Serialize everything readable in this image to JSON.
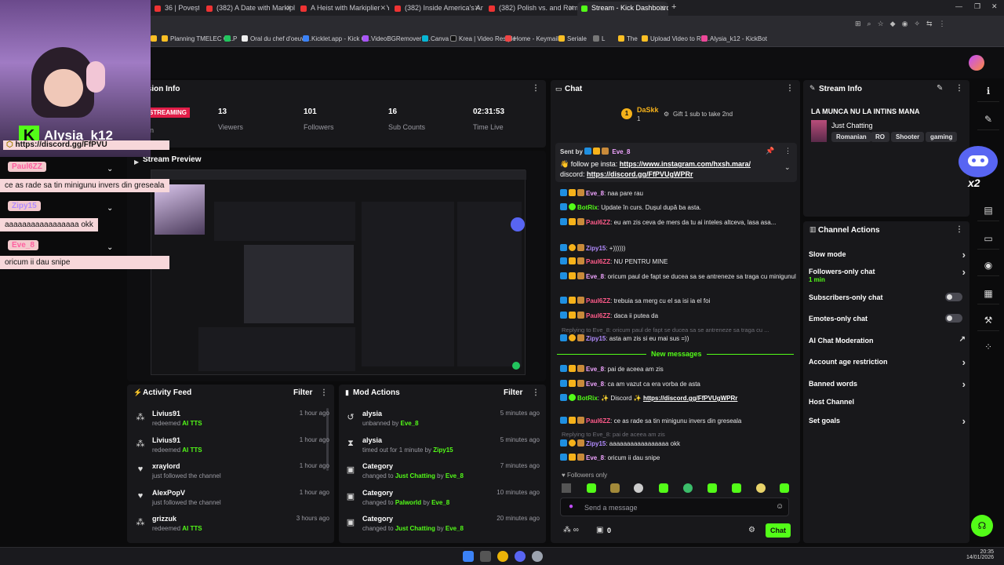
{
  "browser": {
    "tabs": [
      {
        "label": "36 | Povești de F"
      },
      {
        "label": "(382) A Date with Markiplier - Y"
      },
      {
        "label": "A Heist with Markiplier - YouTu"
      },
      {
        "label": "(382) Inside America's Anorexi"
      },
      {
        "label": "(382) Polish vs. and Romanian r"
      },
      {
        "label": "Stream - Kick Dashboard"
      }
    ],
    "bookmarks": [
      "Planning TMELEC G...",
      "P",
      "Oral du chef d'oeuvr...",
      "Kicklet.app - Kick C...",
      "VideoBGRemover -...",
      "Canva",
      "Krea | Video Restyle",
      "Home - Keymailer",
      "Seriale",
      "L",
      "The",
      "Upload Video to Re...",
      "Alysia_k12 - KickBot"
    ]
  },
  "overlay": {
    "streamer": "Alysia_k12",
    "discord": "https://discord.gg/FfPVU",
    "chat": [
      {
        "user": "Paul6ZZ",
        "text": "ce as rade sa tin minigunu invers din greseala"
      },
      {
        "user": "Zipy15",
        "text": "aaaaaaaaaaaaaaaaa okk"
      },
      {
        "user": "Eve_8",
        "text": "oricum ii dau snipe"
      }
    ]
  },
  "session": {
    "title": "Session Info",
    "live_badge": "STREAMING",
    "live_sub": "on",
    "stats": [
      {
        "value": "13",
        "label": "Viewers"
      },
      {
        "value": "101",
        "label": "Followers"
      },
      {
        "value": "16",
        "label": "Sub Counts"
      },
      {
        "value": "02:31:53",
        "label": "Time Live"
      }
    ]
  },
  "preview": {
    "title": "Stream Preview"
  },
  "activity": {
    "title": "Activity Feed",
    "filter": "Filter",
    "rows": [
      {
        "name": "Livius91",
        "action": "redeemed",
        "item": "AI TTS",
        "time": "1 hour ago",
        "icon": "redeem-icon"
      },
      {
        "name": "Livius91",
        "action": "redeemed",
        "item": "AI TTS",
        "time": "1 hour ago",
        "icon": "redeem-icon"
      },
      {
        "name": "xraylord",
        "action": "just followed the channel",
        "item": "",
        "time": "1 hour ago",
        "icon": "heart-icon"
      },
      {
        "name": "AlexPopV",
        "action": "just followed the channel",
        "item": "",
        "time": "1 hour ago",
        "icon": "heart-icon"
      },
      {
        "name": "grizzuk",
        "action": "redeemed",
        "item": "AI TTS",
        "time": "3 hours ago",
        "icon": "redeem-icon"
      }
    ]
  },
  "mod": {
    "title": "Mod Actions",
    "filter": "Filter",
    "rows": [
      {
        "name": "alysia",
        "action": "unbanned by",
        "item": "Eve_8",
        "time": "5 minutes ago",
        "icon": "unban-icon"
      },
      {
        "name": "alysia",
        "action": "timed out for 1 minute by",
        "item": "Zipy15",
        "time": "5 minutes ago",
        "icon": "hourglass-icon"
      },
      {
        "name": "Category",
        "action": "changed to",
        "item": "Just Chatting",
        "by": "by",
        "user": "Eve_8",
        "time": "7 minutes ago",
        "icon": "category-icon"
      },
      {
        "name": "Category",
        "action": "changed to",
        "item": "Palworld",
        "by": "by",
        "user": "Eve_8",
        "time": "10 minutes ago",
        "icon": "category-icon"
      },
      {
        "name": "Category",
        "action": "changed to",
        "item": "Just Chatting",
        "by": "by",
        "user": "Eve_8",
        "time": "20 minutes ago",
        "icon": "category-icon"
      }
    ]
  },
  "chat": {
    "title": "Chat",
    "gifter": "DaSkk",
    "gifter_count": "1",
    "gift_text": "Gift 1 sub to take 2nd",
    "pinned": {
      "sent_by": "Sent by",
      "user": "Eve_8",
      "text1": "follow pe insta:",
      "link1": "https://www.instagram.com/hxsh.mara/",
      "text2": "discord:",
      "link2": "https://discord.gg/FfPVUgWPRr"
    },
    "messages": [
      {
        "user": "Eve_8",
        "cls": "u-eve",
        "text": "naa pare rau"
      },
      {
        "user": "BotRix",
        "cls": "u-bot",
        "text": "Update în curs. Dușul după ba asta."
      },
      {
        "user": "Paul6ZZ",
        "cls": "u-paul",
        "text": "eu am zis ceva de mers da tu ai inteles altceva, lasa asa..."
      },
      {
        "user": "Zipy15",
        "cls": "u-zipy",
        "text": "+))))))"
      },
      {
        "user": "Paul6ZZ",
        "cls": "u-paul",
        "text": "NU PENTRU MINE"
      },
      {
        "user": "Eve_8",
        "cls": "u-eve",
        "text": "oricum paul de fapt se ducea sa se antreneze sa traga cu minigunul"
      },
      {
        "user": "Paul6ZZ",
        "cls": "u-paul",
        "text": "trebuia sa merg cu el sa isi ia el foi"
      },
      {
        "user": "Paul6ZZ",
        "cls": "u-paul",
        "text": "daca ii putea da"
      },
      {
        "user": "Zipy15",
        "cls": "u-zipy",
        "text": "asta am zis si eu mai sus =))"
      }
    ],
    "reply1": "Replying to Eve_8: oricum paul de fapt se ducea sa se antreneze sa traga cu ...",
    "new_messages": "New messages",
    "messages2": [
      {
        "user": "Eve_8",
        "cls": "u-eve",
        "text": "pai de aceea am zis"
      },
      {
        "user": "Eve_8",
        "cls": "u-eve",
        "text": "ca am vazut ca era vorba de asta"
      },
      {
        "user": "BotRix",
        "cls": "u-bot",
        "text": "✨ Discord ✨",
        "link": "https://discord.gg/FfPVUgWPRr"
      },
      {
        "user": "Paul6ZZ",
        "cls": "u-paul",
        "text": "ce as rade sa tin minigunu invers din greseala"
      }
    ],
    "reply2": "Replying to Eve_8: pai de aceea am zis",
    "messages3": [
      {
        "user": "Zipy15",
        "cls": "u-zipy",
        "text": "aaaaaaaaaaaaaaaaa okk"
      },
      {
        "user": "Eve_8",
        "cls": "u-eve",
        "text": "oricum ii dau snipe"
      }
    ],
    "followers_only": "Followers only",
    "input_placeholder": "Send a message",
    "viewer_count": "0",
    "send": "Chat"
  },
  "stream_info": {
    "title": "Stream Info",
    "stream_title": "LA MUNCA NU LA INTINS MANA",
    "category": "Just Chatting",
    "tags": [
      "Romanian",
      "RO",
      "Shooter",
      "gaming"
    ]
  },
  "channel_actions": {
    "title": "Channel Actions",
    "items": [
      {
        "label": "Slow mode",
        "kind": "chevron"
      },
      {
        "label": "Followers-only chat",
        "sub": "1 min",
        "kind": "chevron"
      },
      {
        "label": "Subscribers-only chat",
        "kind": "toggle"
      },
      {
        "label": "Emotes-only chat",
        "kind": "toggle"
      },
      {
        "label": "AI Chat Moderation",
        "kind": "external"
      },
      {
        "label": "Account age restriction",
        "kind": "chevron"
      },
      {
        "label": "Banned words",
        "kind": "chevron"
      },
      {
        "label": "Host Channel",
        "kind": "none"
      },
      {
        "label": "Set goals",
        "kind": "chevron"
      }
    ]
  },
  "taskbar": {
    "time": "20:35",
    "date": "14/01/2026"
  },
  "colors": {
    "accent": "#53fc18",
    "panel": "#18181b",
    "bg": "#0b0b0c"
  }
}
